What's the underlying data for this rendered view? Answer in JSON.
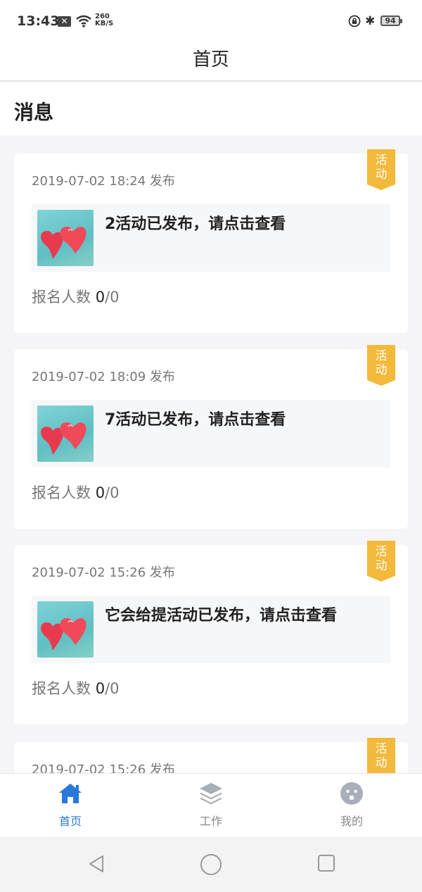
{
  "status": {
    "time": "13:43",
    "speed_top": "260",
    "speed_bottom": "KB/S",
    "battery": "94",
    "bluetooth_icon": "bluetooth-icon"
  },
  "header": {
    "title": "首页"
  },
  "section": {
    "title": "消息"
  },
  "cards": [
    {
      "date": "2019-07-02 18:24 发布",
      "tag_line1": "活",
      "tag_line2": "动",
      "message": "2活动已发布，请点击查看",
      "signup_label": "报名人数 ",
      "signup_count": "0",
      "signup_total": "/0"
    },
    {
      "date": "2019-07-02 18:09 发布",
      "tag_line1": "活",
      "tag_line2": "动",
      "message": "7活动已发布，请点击查看",
      "signup_label": "报名人数 ",
      "signup_count": "0",
      "signup_total": "/0"
    },
    {
      "date": "2019-07-02 15:26 发布",
      "tag_line1": "活",
      "tag_line2": "动",
      "message": "它会给提活动已发布，请点击查看",
      "signup_label": "报名人数 ",
      "signup_count": "0",
      "signup_total": "/0"
    },
    {
      "date": "2019-07-02 15:26 发布",
      "tag_line1": "活",
      "tag_line2": "动",
      "message": "",
      "signup_label": "",
      "signup_count": "",
      "signup_total": ""
    }
  ],
  "tabs": [
    {
      "label": "首页",
      "icon": "home-icon",
      "active": true
    },
    {
      "label": "工作",
      "icon": "layers-icon",
      "active": false
    },
    {
      "label": "我的",
      "icon": "profile-face-icon",
      "active": false
    }
  ],
  "colors": {
    "accent": "#2a78d8",
    "tag": "#f3b93b",
    "muted": "#777777"
  }
}
